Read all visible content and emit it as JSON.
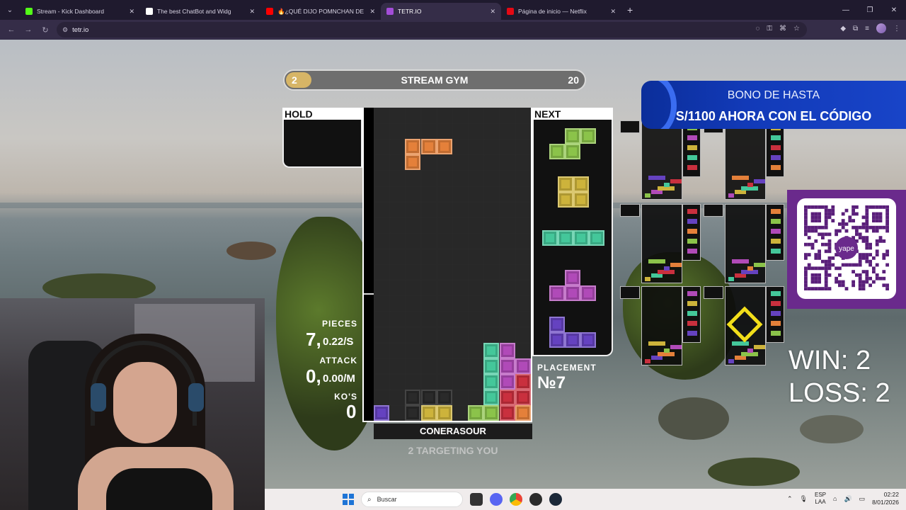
{
  "browser": {
    "tabs": [
      {
        "title": "Stream - Kick Dashboard",
        "color": "#53fc18",
        "active": false
      },
      {
        "title": "The best ChatBot and Widg",
        "color": "#ffffff",
        "active": false
      },
      {
        "title": "🔥¿QUÉ DIJO POMNCHAN DE",
        "color": "#ff0000",
        "active": false
      },
      {
        "title": "TETR.IO",
        "color": "#a34dd8",
        "active": true
      },
      {
        "title": "Página de inicio — Netflix",
        "color": "#e50914",
        "active": false
      }
    ],
    "url": "tetr.io",
    "new_tab": "+",
    "window_controls": {
      "minimize": "—",
      "maximize": "❐",
      "close": "✕"
    }
  },
  "game": {
    "mode_left": "2",
    "mode_title": "STREAM GYM",
    "mode_right": "20",
    "hold_label": "HOLD",
    "next_label": "NEXT",
    "pieces_label": "PIECES",
    "pieces_count": "7,",
    "pieces_rate": "0.22/S",
    "attack_label": "ATTACK",
    "attack_count": "0,",
    "attack_rate": "0.00/M",
    "kos_label": "KO'S",
    "kos_count": "0",
    "placement_label": "PLACEMENT",
    "placement_value": "№7",
    "player_name": "CONERASOUR",
    "targeting": "2 TARGETING YOU"
  },
  "overlay": {
    "ad_line1": "BONO DE HASTA",
    "ad_line2": "S/1100 AHORA CON EL CÓDIGO",
    "qr_brand": "yape",
    "win": "WIN: 2",
    "loss": "LOSS: 2"
  },
  "taskbar": {
    "search_placeholder": "Buscar",
    "lang_top": "ESP",
    "lang_bottom": "LAA",
    "time": "02:22",
    "date": "8/01/2026"
  }
}
